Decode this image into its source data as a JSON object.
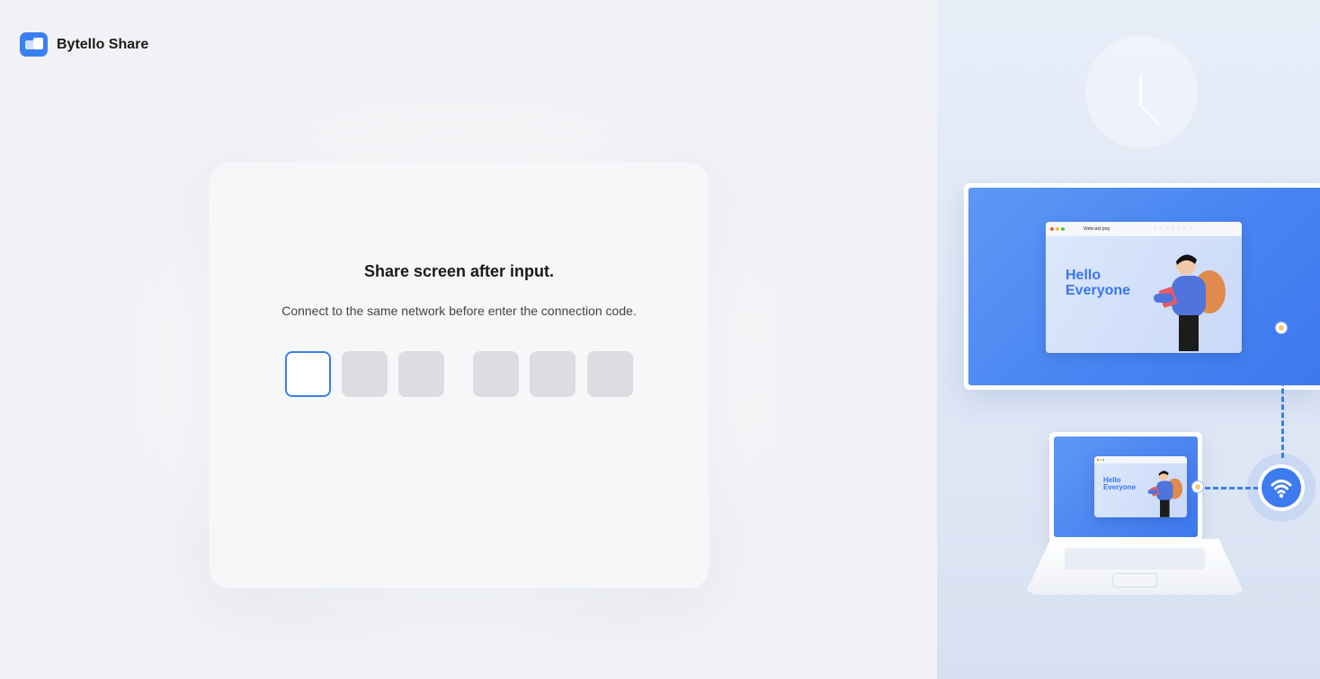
{
  "app": {
    "name": "Bytello Share"
  },
  "card": {
    "title": "Share screen after input.",
    "subtitle": "Connect to the same network before enter the connection code.",
    "code_inputs": [
      "",
      "",
      "",
      "",
      "",
      ""
    ],
    "active_index": 0
  },
  "illustration": {
    "monitor_greeting": [
      "Hello",
      "Everyone"
    ],
    "monitor_window_title": "Webcast.png",
    "laptop_greeting": [
      "Hello",
      "Everyone"
    ]
  },
  "colors": {
    "accent": "#3e7cf0",
    "code_box_empty": "#dcdde0",
    "background": "#f1f2f5",
    "card": "#f6f7f9"
  },
  "icons": [
    "app-logo-icon",
    "clock-icon",
    "wifi-icon"
  ]
}
